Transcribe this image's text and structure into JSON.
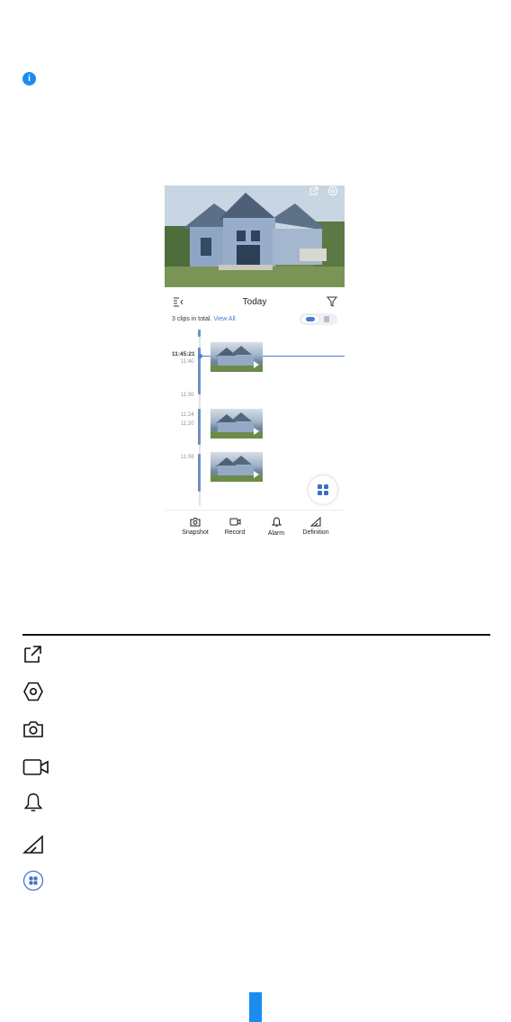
{
  "info_icon": {
    "glyph": "i",
    "color": "#1a8cf0"
  },
  "phone": {
    "live_view": {
      "icons": [
        "share-icon",
        "settings-icon"
      ]
    },
    "header": {
      "title": "Today",
      "icons": [
        "collapse-list-icon",
        "filter-icon"
      ]
    },
    "clips": {
      "summary": "3 clips in total.",
      "link": "View All"
    },
    "view_toggle": {
      "options": [
        "cloud-icon",
        "sd-card-icon"
      ],
      "selected": "cloud-icon"
    },
    "timeline": {
      "current_time": "11:45:21",
      "labels": [
        "11:40",
        "11:30",
        "11:24",
        "11:20",
        "11:08"
      ],
      "clip_count": 3
    },
    "more_button": {
      "icon": "grid-icon"
    },
    "bottom_bar": {
      "items": [
        {
          "label": "Snapshot",
          "icon": "camera-icon"
        },
        {
          "label": "Record",
          "icon": "video-icon"
        },
        {
          "label": "Alarm",
          "icon": "bell-icon"
        },
        {
          "label": "Definition",
          "icon": "definition-icon"
        }
      ]
    },
    "accent_color": "#4a7ccf"
  },
  "legend": {
    "icons": [
      "share-icon",
      "settings-icon",
      "camera-icon",
      "video-icon",
      "bell-icon",
      "definition-icon",
      "grid-icon"
    ]
  },
  "page_tab_color": "#1a8cf0"
}
